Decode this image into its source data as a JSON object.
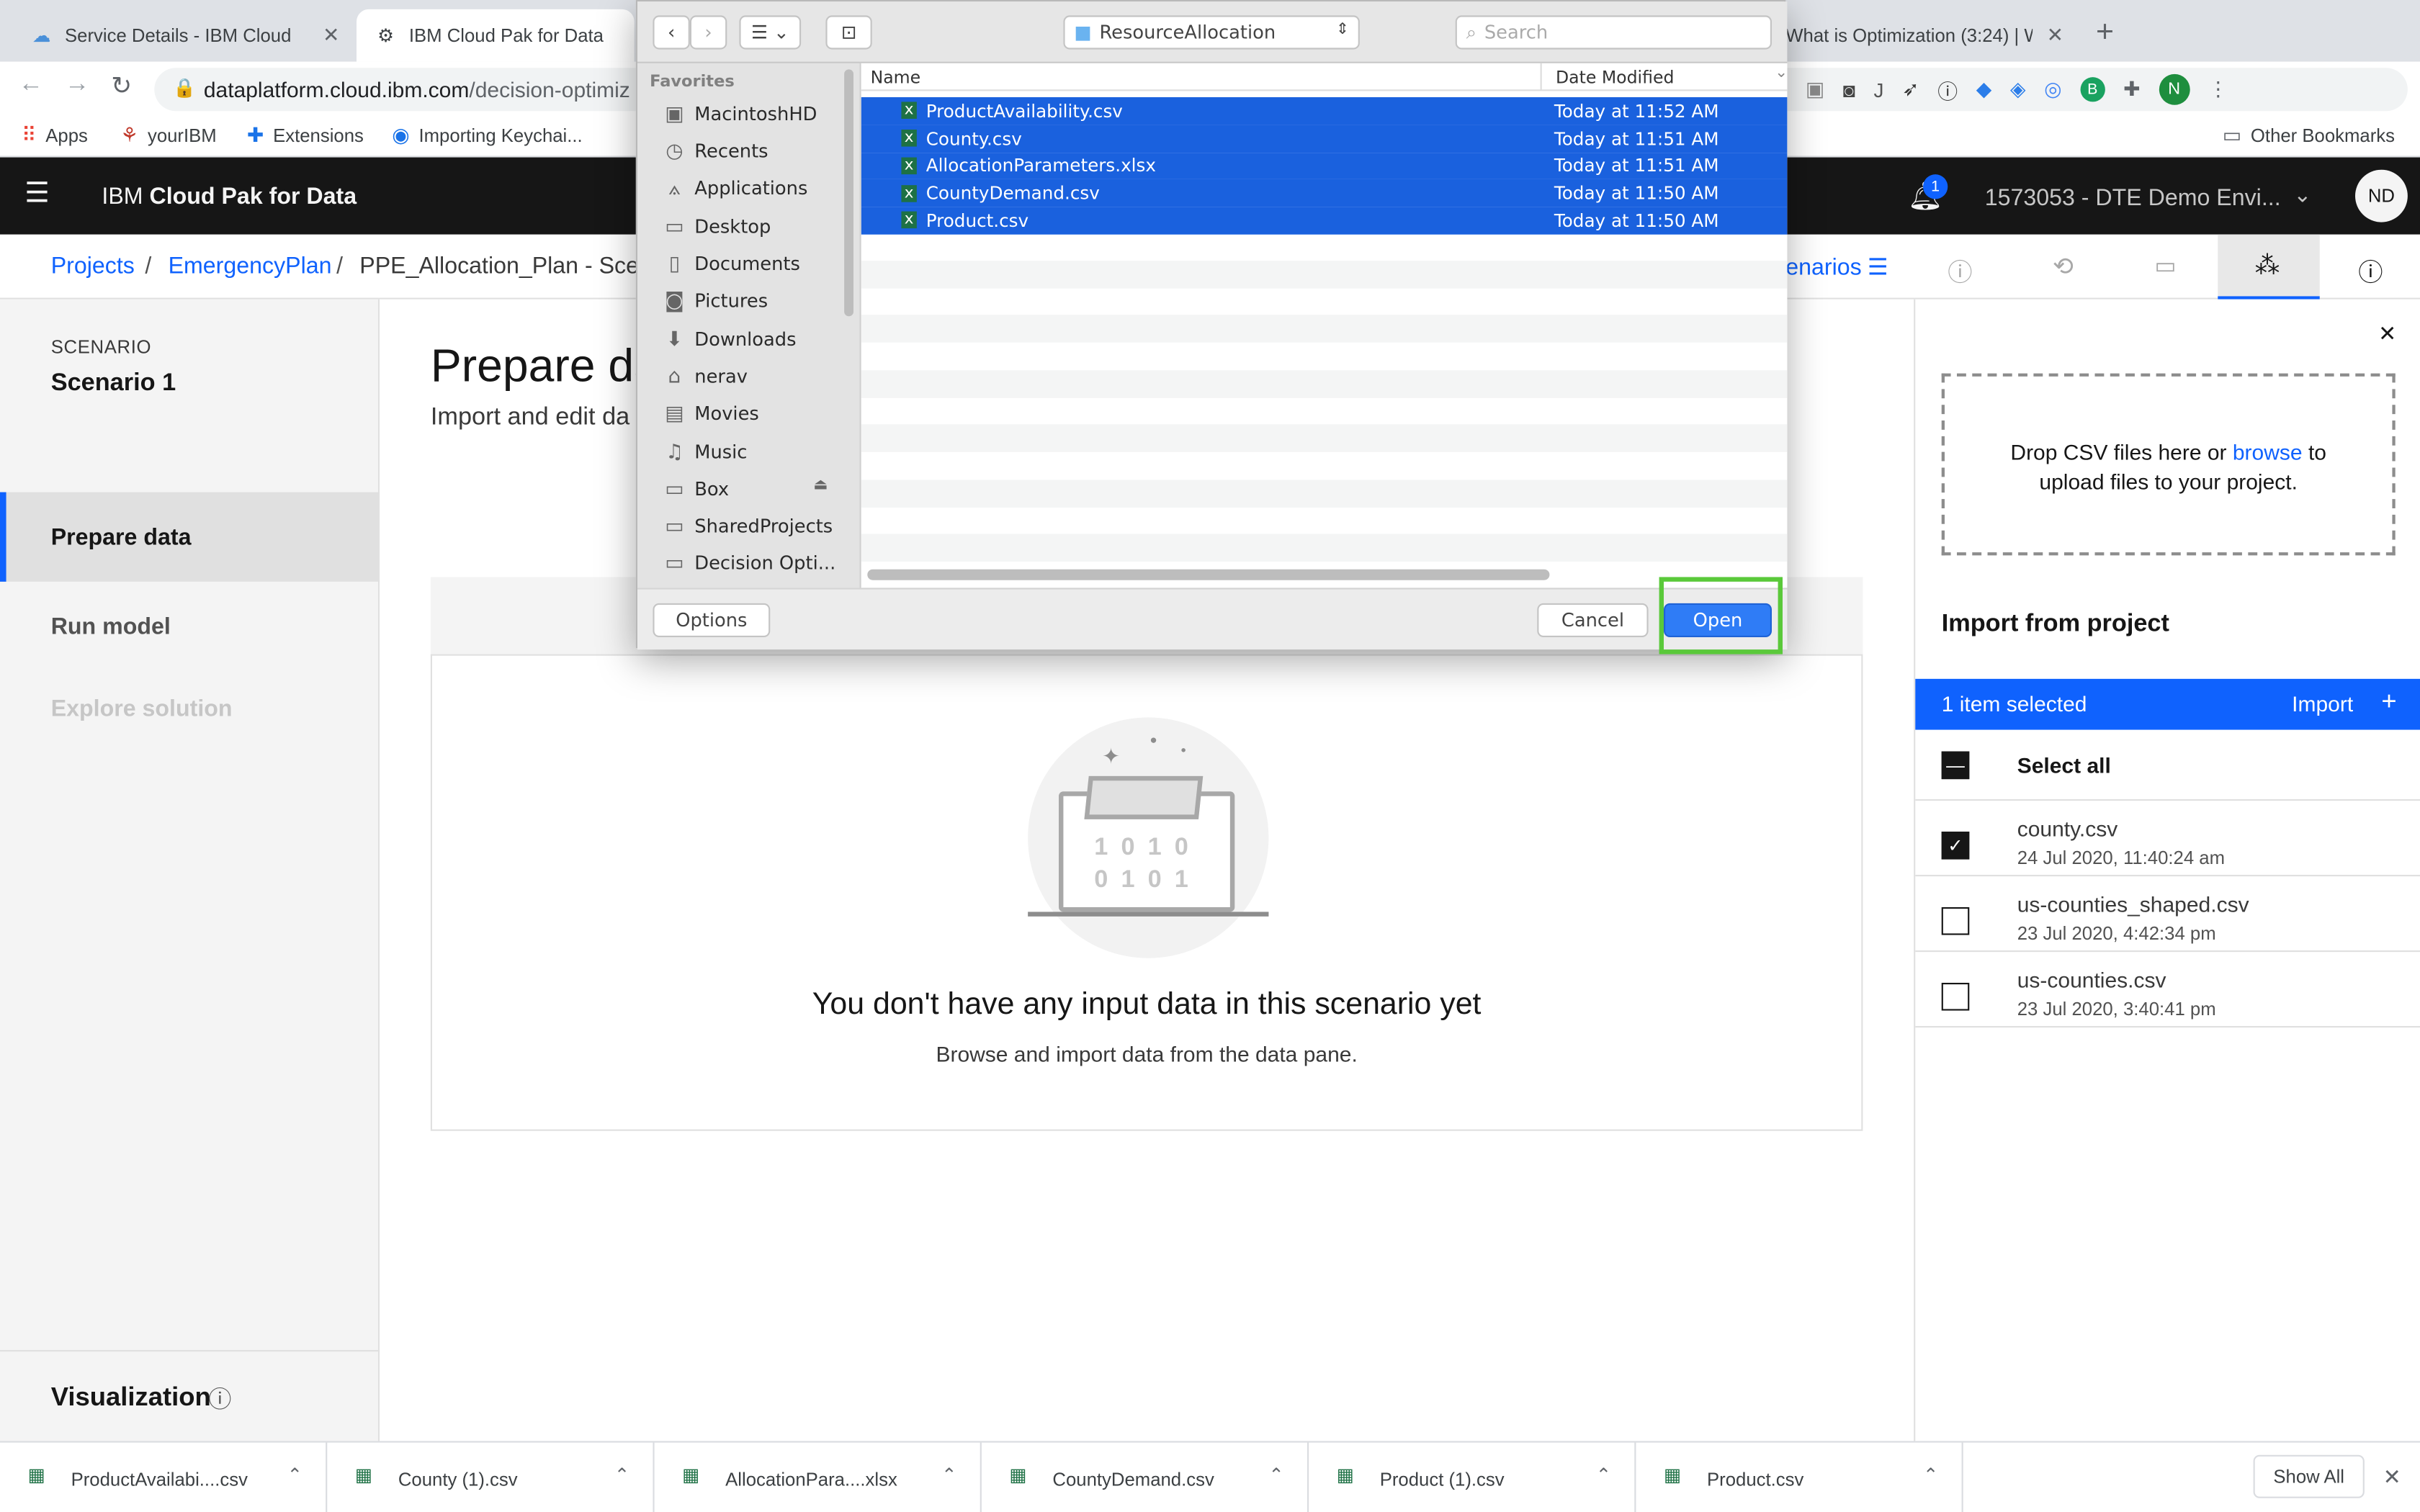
{
  "browser": {
    "tabs": [
      {
        "title": "Service Details - IBM Cloud"
      },
      {
        "title": "IBM Cloud Pak for Data"
      },
      {
        "title": "What is Optimization (3:24) | W"
      }
    ],
    "url_host": "dataplatform.cloud.ibm.com",
    "url_path": "/decision-optimiz",
    "bookmarks": [
      "Apps",
      "yourIBM",
      "Extensions",
      "Importing Keychai..."
    ],
    "other_bookmarks": "Other Bookmarks",
    "profile_initial": "N"
  },
  "header": {
    "brand_prefix": "IBM",
    "brand_name": "Cloud Pak for Data",
    "notification_count": "1",
    "environment": "1573053 - DTE Demo Envi...",
    "avatar": "ND"
  },
  "breadcrumb": {
    "items": [
      "Projects",
      "EmergencyPlan",
      "PPE_Allocation_Plan - Scen"
    ],
    "scenarios_link": "enarios"
  },
  "leftnav": {
    "section_label": "SCENARIO",
    "scenario_name": "Scenario 1",
    "items": [
      "Prepare data",
      "Run model",
      "Explore solution"
    ],
    "footer": "Visualization"
  },
  "main": {
    "title": "Prepare da",
    "subtitle": "Import and edit da",
    "binary_line1": "1 0 1 0",
    "binary_line2": "0 1 0 1",
    "empty_title": "You don't have any input data in this scenario yet",
    "empty_desc": "Browse and import data from the data pane."
  },
  "right_panel": {
    "drop_text_before": "Drop CSV files here or ",
    "drop_link": "browse",
    "drop_text_after": " to upload files to your project.",
    "import_title": "Import from project",
    "selected_count": "1 item selected",
    "import_button": "Import",
    "select_all": "Select all",
    "files": [
      {
        "name": "county.csv",
        "date": "24 Jul 2020, 11:40:24 am",
        "checked": true
      },
      {
        "name": "us-counties_shaped.csv",
        "date": "23 Jul 2020, 4:42:34 pm",
        "checked": false
      },
      {
        "name": "us-counties.csv",
        "date": "23 Jul 2020, 3:40:41 pm",
        "checked": false
      }
    ]
  },
  "dialog": {
    "location": "ResourceAllocation",
    "search_placeholder": "Search",
    "favorites_label": "Favorites",
    "sidebar": [
      "MacintoshHD",
      "Recents",
      "Applications",
      "Desktop",
      "Documents",
      "Pictures",
      "Downloads",
      "nerav",
      "Movies",
      "Music",
      "Box",
      "SharedProjects",
      "Decision Opti..."
    ],
    "col_name": "Name",
    "col_date": "Date Modified",
    "files": [
      {
        "name": "ProductAvailability.csv",
        "date": "Today at 11:52 AM"
      },
      {
        "name": "County.csv",
        "date": "Today at 11:51 AM"
      },
      {
        "name": "AllocationParameters.xlsx",
        "date": "Today at 11:51 AM"
      },
      {
        "name": "CountyDemand.csv",
        "date": "Today at 11:50 AM"
      },
      {
        "name": "Product.csv",
        "date": "Today at 11:50 AM"
      }
    ],
    "options_button": "Options",
    "cancel_button": "Cancel",
    "open_button": "Open"
  },
  "downloads": {
    "items": [
      "ProductAvailabi....csv",
      "County (1).csv",
      "AllocationPara....xlsx",
      "CountyDemand.csv",
      "Product (1).csv",
      "Product.csv"
    ],
    "show_all": "Show All"
  },
  "colors": {
    "ibm_blue": "#0f62fe",
    "mac_selection": "#1a61de",
    "highlight_box": "#5ac93a"
  }
}
